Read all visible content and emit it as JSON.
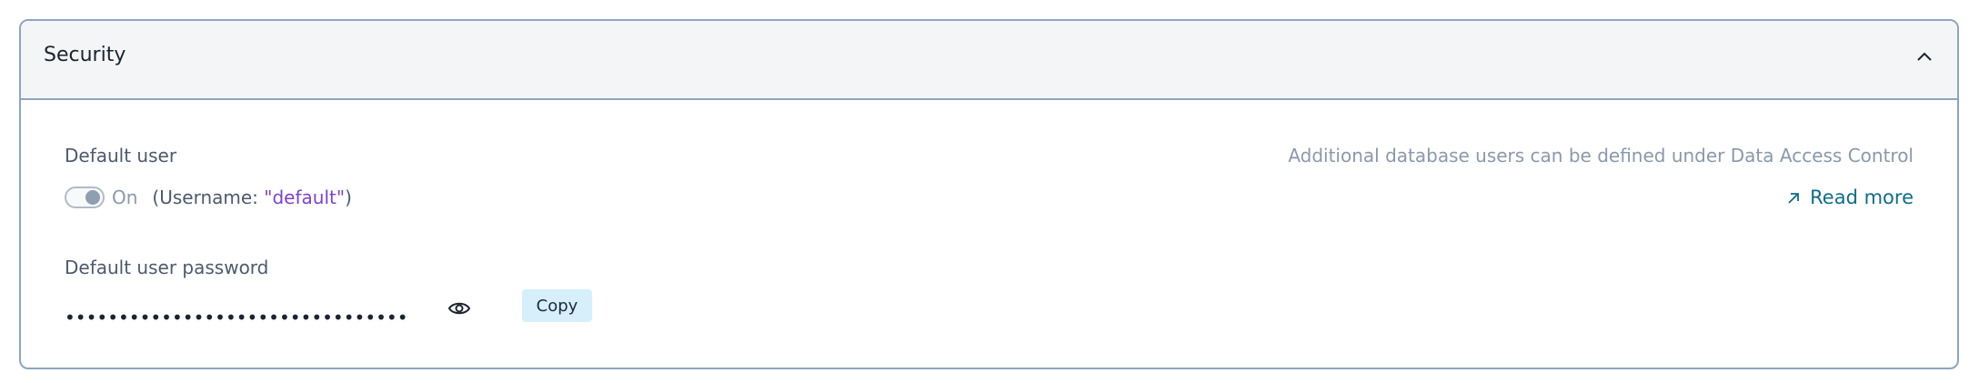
{
  "section": {
    "title": "Security",
    "collapse_icon": "chevron-up-icon"
  },
  "default_user": {
    "label": "Default user",
    "toggle_state": "On",
    "toggle_on": true,
    "username_prefix": "(Username: ",
    "username_value": "\"default\"",
    "username_suffix": ")"
  },
  "info": {
    "note": "Additional database users can be defined under Data Access Control",
    "read_more_label": "Read more",
    "read_more_icon": "arrow-up-right-icon"
  },
  "password": {
    "label": "Default user password",
    "masked_value": "••••••••••••••••••••••••••••••••",
    "reveal_icon": "eye-icon",
    "copy_label": "Copy"
  },
  "colors": {
    "border": "#8da6bd",
    "header_bg": "#f4f5f7",
    "link": "#0f6d86",
    "username_highlight": "#7c43c8",
    "copy_button_bg": "#d6effb"
  }
}
